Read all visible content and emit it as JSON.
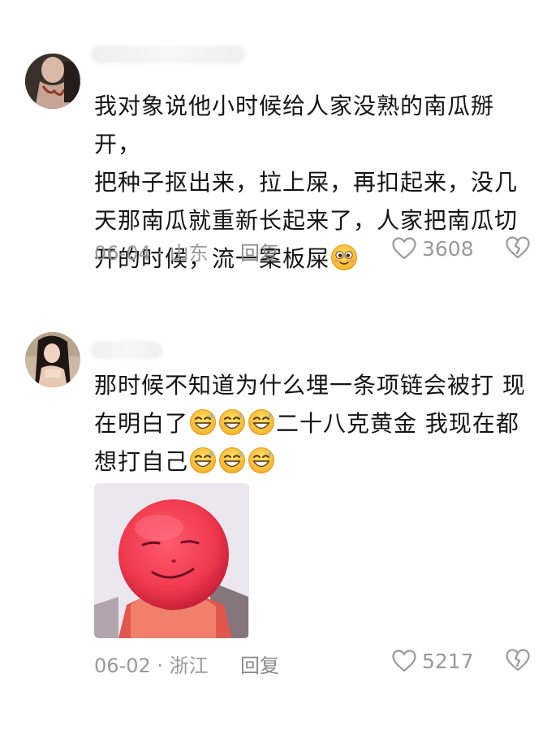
{
  "comments": [
    {
      "text_lines": [
        "我对象说他小时候给人家没熟的南瓜掰开，",
        "把种子抠出来，拉上屎，再扣起来，没几",
        "天那南瓜就重新长起来了，人家把南瓜切",
        "开的时候，流一案板屎"
      ],
      "trailing_emojis": [
        "blush-smile-emoji"
      ],
      "date_location": "06-04 · 山东",
      "reply_label": "回复",
      "likes": "3608",
      "like_icon": "heart-outline-icon",
      "dislike_icon": "broken-heart-icon"
    },
    {
      "text_lines": [
        "那时候不知道为什么埋一条项链会被打 现",
        "在明白了",
        "二十八克黄金 我现在都",
        "想打自己"
      ],
      "emojis": [
        "grin-sweat-emoji",
        "grin-sweat-emoji",
        "grin-sweat-emoji"
      ],
      "date_location": "06-02 · 浙江",
      "reply_label": "回复",
      "likes": "5217",
      "like_icon": "heart-outline-icon",
      "dislike_icon": "broken-heart-icon",
      "sticker": "red-face-meme-sticker"
    }
  ],
  "colors": {
    "meta_text": "#9a9a9a",
    "body_text": "#141414",
    "sticker_red": "#f0405a"
  }
}
